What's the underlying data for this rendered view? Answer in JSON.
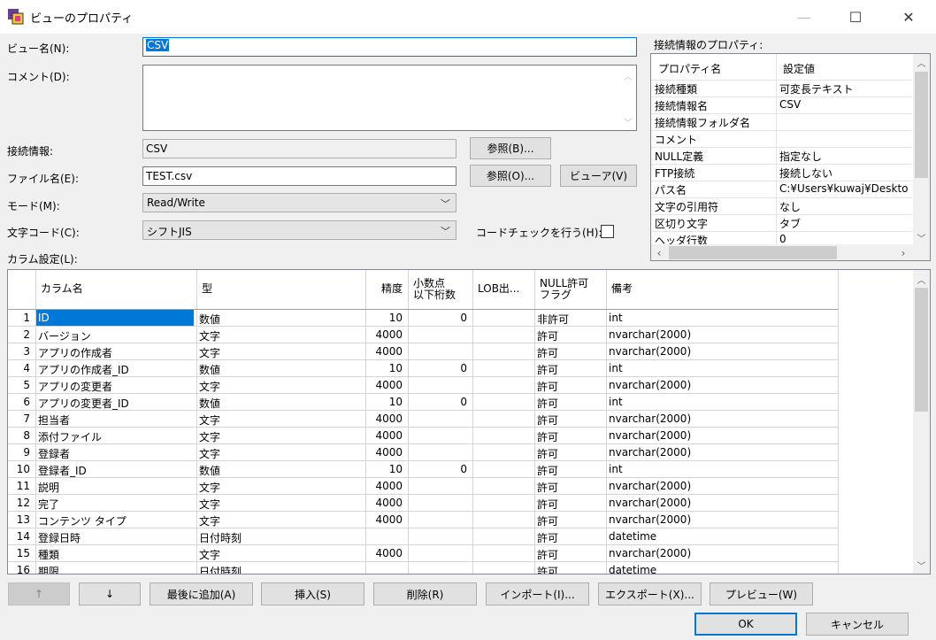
{
  "window": {
    "title": "ビューのプロパティ",
    "minimize": "—",
    "maximize": "☐",
    "close": "✕"
  },
  "form": {
    "view_name_label": "ビュー名(N):",
    "view_name_value": "CSV",
    "comment_label": "コメント(D):",
    "comment_value": "",
    "connection_label": "接続情報:",
    "connection_value": "CSV",
    "browse1_label": "参照(B)...",
    "filename_label": "ファイル名(E):",
    "filename_value": "TEST.csv",
    "browse2_label": "参照(O)...",
    "viewer_label": "ビューア(V)",
    "mode_label": "モード(M):",
    "mode_value": "Read/Write",
    "charset_label": "文字コード(C):",
    "charset_value": "シフトJIS",
    "codecheck_label": "コードチェックを行う(H):",
    "columns_label": "カラム設定(L):"
  },
  "props": {
    "title": "接続情報のプロパティ:",
    "headers": [
      "プロパティ名",
      "設定値"
    ],
    "rows": [
      [
        "接続種類",
        "可変長テキスト"
      ],
      [
        "接続情報名",
        "CSV"
      ],
      [
        "接続情報フォルダ名",
        ""
      ],
      [
        "コメント",
        ""
      ],
      [
        "NULL定義",
        "指定なし"
      ],
      [
        "FTP接続",
        "接続しない"
      ],
      [
        "パス名",
        "C:¥Users¥kuwaj¥Deskto"
      ],
      [
        "文字の引用符",
        "なし"
      ],
      [
        "区切り文字",
        "タブ"
      ],
      [
        "ヘッダ行数",
        "0"
      ]
    ]
  },
  "grid": {
    "headers": [
      "カラム名",
      "型",
      "精度",
      "小数点\n以下桁数",
      "LOB出...",
      "NULL許可\nフラグ",
      "備考"
    ],
    "rows": [
      [
        "1",
        "ID",
        "数値",
        "10",
        "0",
        "",
        "非許可",
        "int"
      ],
      [
        "2",
        "バージョン",
        "文字",
        "4000",
        "",
        "",
        "許可",
        "nvarchar(2000)"
      ],
      [
        "3",
        "アプリの作成者",
        "文字",
        "4000",
        "",
        "",
        "許可",
        "nvarchar(2000)"
      ],
      [
        "4",
        "アプリの作成者_ID",
        "数値",
        "10",
        "0",
        "",
        "許可",
        "int"
      ],
      [
        "5",
        "アプリの変更者",
        "文字",
        "4000",
        "",
        "",
        "許可",
        "nvarchar(2000)"
      ],
      [
        "6",
        "アプリの変更者_ID",
        "数値",
        "10",
        "0",
        "",
        "許可",
        "int"
      ],
      [
        "7",
        "担当者",
        "文字",
        "4000",
        "",
        "",
        "許可",
        "nvarchar(2000)"
      ],
      [
        "8",
        "添付ファイル",
        "文字",
        "4000",
        "",
        "",
        "許可",
        "nvarchar(2000)"
      ],
      [
        "9",
        "登録者",
        "文字",
        "4000",
        "",
        "",
        "許可",
        "nvarchar(2000)"
      ],
      [
        "10",
        "登録者_ID",
        "数値",
        "10",
        "0",
        "",
        "許可",
        "int"
      ],
      [
        "11",
        "説明",
        "文字",
        "4000",
        "",
        "",
        "許可",
        "nvarchar(2000)"
      ],
      [
        "12",
        "完了",
        "文字",
        "4000",
        "",
        "",
        "許可",
        "nvarchar(2000)"
      ],
      [
        "13",
        "コンテンツ タイプ",
        "文字",
        "4000",
        "",
        "",
        "許可",
        "nvarchar(2000)"
      ],
      [
        "14",
        "登録日時",
        "日付時刻",
        "",
        "",
        "",
        "許可",
        "datetime"
      ],
      [
        "15",
        "種類",
        "文字",
        "4000",
        "",
        "",
        "許可",
        "nvarchar(2000)"
      ],
      [
        "16",
        "期限",
        "日付時刻",
        "",
        "",
        "",
        "許可",
        "datetime"
      ]
    ]
  },
  "buttons": {
    "up": "↑",
    "down": "↓",
    "append": "最後に追加(A)",
    "insert": "挿入(S)",
    "delete": "削除(R)",
    "import": "インポート(I)...",
    "export": "エクスポート(X)...",
    "preview": "プレビュー(W)",
    "ok": "OK",
    "cancel": "キャンセル"
  },
  "colors": {
    "selection": "#0078d7",
    "accent": "#0078d7"
  }
}
